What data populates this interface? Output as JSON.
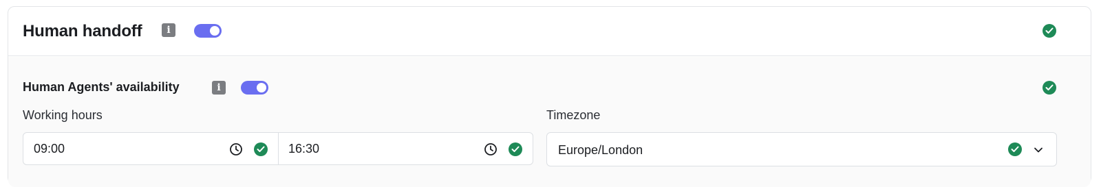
{
  "header": {
    "title": "Human handoff",
    "info_icon": "info-icon",
    "enabled": true,
    "status_icon": "check-circle-icon"
  },
  "availability": {
    "title": "Human Agents' availability",
    "info_icon": "info-icon",
    "enabled": true,
    "status_icon": "check-circle-icon",
    "working_hours": {
      "label": "Working hours",
      "start": "09:00",
      "end": "16:30"
    },
    "timezone": {
      "label": "Timezone",
      "value": "Europe/London"
    }
  },
  "colors": {
    "accent": "#6a6ef0",
    "success": "#1e8a57",
    "info_icon_bg": "#7b7d81",
    "border": "#dcdfe3"
  }
}
